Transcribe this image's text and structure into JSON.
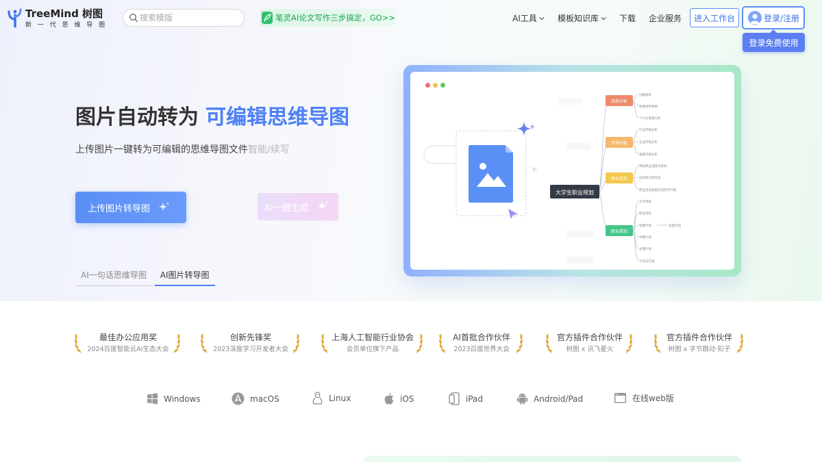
{
  "header": {
    "logo": {
      "title": "TreeMind 树图",
      "tagline": "新 一 代 思 维 导 图"
    },
    "search": {
      "placeholder": "搜索模版"
    },
    "promo": {
      "text": "笔灵AI论文写作三步搞定，GO>>"
    },
    "nav": [
      {
        "label": "AI工具",
        "has_dropdown": true
      },
      {
        "label": "模板知识库",
        "has_dropdown": true
      },
      {
        "label": "下载",
        "has_dropdown": false
      },
      {
        "label": "企业服务",
        "has_dropdown": false
      }
    ],
    "workbench_button": "进入工作台",
    "login_button": "登录/注册",
    "login_tooltip": "登录免费使用"
  },
  "hero": {
    "title_part1": "图片自动转为",
    "title_part2": "可编辑思维导图",
    "subtitle": "上传图片一键转为可编辑的思维导图文件",
    "subtitle_fade": "智能/续写",
    "primary_cta": "上传图片转导图",
    "secondary_cta": "AI一键生成",
    "tabs": [
      {
        "label": "AI一句话思维导图",
        "active": false
      },
      {
        "label": "AI图片转导图",
        "active": true
      }
    ]
  },
  "preview": {
    "root": "大学生职业规划",
    "branches": [
      {
        "label": "自我分析",
        "color": "#ee8a6b",
        "children": [
          "兴趣爱好",
          "性格优势特质",
          "个人价值观分析"
        ]
      },
      {
        "label": "环境分析",
        "color": "#f5b86a",
        "children": [
          "行业环境分析",
          "企业环境分析",
          "家庭环境分析"
        ]
      },
      {
        "label": "职业定位",
        "color": "#f3c94c",
        "children": [
          "目标职业选择与规划",
          "自身能力的优劣",
          "职业生涯发展方向的可行性"
        ]
      },
      {
        "label": "职业规划",
        "color": "#46c68a",
        "children": [
          "大学目标",
          "职业目标",
          "短期计划",
          "中期计划",
          "长期计划",
          "计划与实施"
        ]
      }
    ],
    "side_note": "实践行动"
  },
  "awards": [
    {
      "title": "最佳办公应用奖",
      "sub": "2024百度智能云AI生态大会"
    },
    {
      "title": "创新先锋奖",
      "sub": "2023深度学习开发者大会"
    },
    {
      "title": "上海人工智能行业协会",
      "sub": "会员单位旗下产品"
    },
    {
      "title": "AI首批合作伙伴",
      "sub": "2023百度世界大会"
    },
    {
      "title": "官方插件合作伙伴",
      "sub": "树图 x 讯飞星火"
    },
    {
      "title": "官方插件合作伙伴",
      "sub": "树图 x 字节跳动·扣子"
    }
  ],
  "platforms": [
    {
      "label": "Windows",
      "icon": "windows-icon"
    },
    {
      "label": "macOS",
      "icon": "appstore-icon"
    },
    {
      "label": "Linux",
      "icon": "linux-icon"
    },
    {
      "label": "iOS",
      "icon": "apple-icon"
    },
    {
      "label": "iPad",
      "icon": "ipad-icon"
    },
    {
      "label": "Android/Pad",
      "icon": "android-icon"
    },
    {
      "label": "在线web版",
      "icon": "browser-icon"
    }
  ],
  "colors": {
    "accent": "#4f7df3",
    "promo_green": "#1aa352",
    "laurel_gold": "#e0a93b"
  }
}
